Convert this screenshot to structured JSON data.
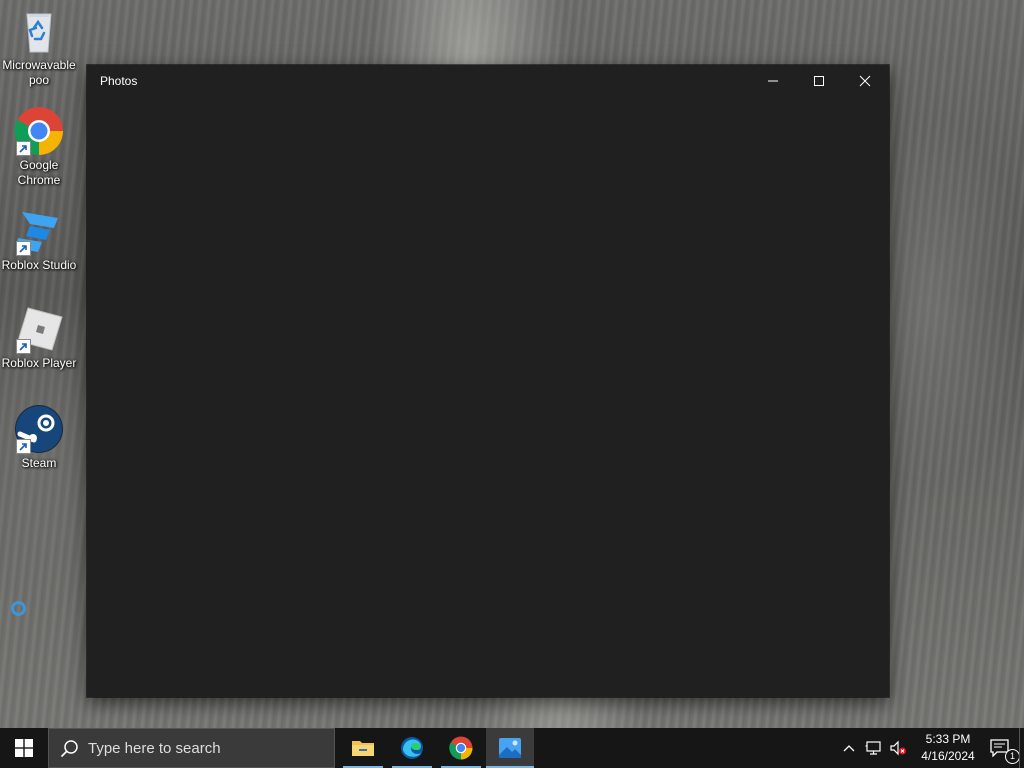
{
  "desktop": {
    "icons": [
      {
        "label": "Microwavable poo",
        "icon": "recycle-bin-icon"
      },
      {
        "label": "Google Chrome",
        "icon": "chrome-icon"
      },
      {
        "label": "Roblox Studio",
        "icon": "roblox-studio-icon"
      },
      {
        "label": "Roblox Player",
        "icon": "roblox-player-icon"
      },
      {
        "label": "Steam",
        "icon": "steam-icon"
      }
    ]
  },
  "window": {
    "title": "Photos",
    "background": "#202020",
    "controls": [
      "minimize-icon",
      "maximize-icon",
      "close-icon"
    ]
  },
  "taskbar": {
    "search_placeholder": "Type here to search",
    "apps": [
      {
        "name": "File Explorer",
        "icon": "folder-icon"
      },
      {
        "name": "Microsoft Edge",
        "icon": "edge-icon"
      },
      {
        "name": "Google Chrome",
        "icon": "chrome-icon"
      },
      {
        "name": "Photos",
        "icon": "photos-icon",
        "active": true
      }
    ],
    "accent": "#76b9ed",
    "clock": {
      "time": "5:33 PM",
      "date": "4/16/2024"
    },
    "notifications_count": "1"
  }
}
